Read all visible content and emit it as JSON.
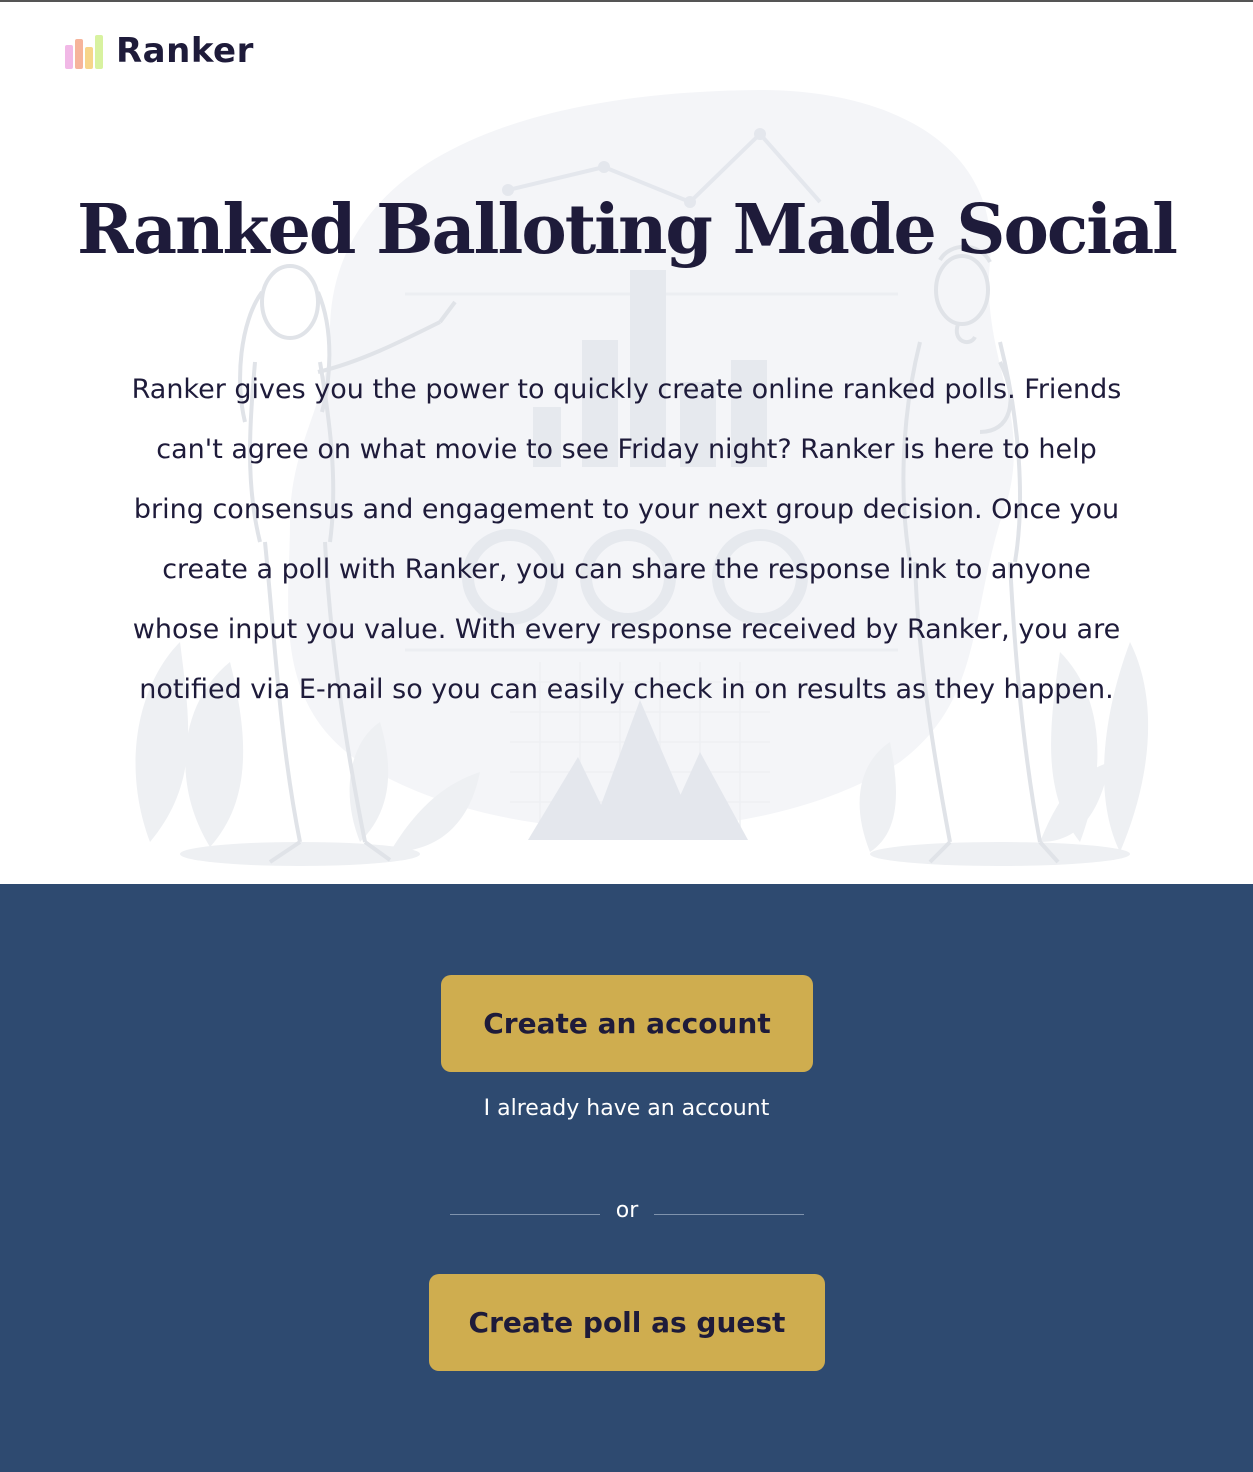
{
  "brand": {
    "name": "Ranker",
    "logo_colors": [
      "#f1b8e6",
      "#f6b49b",
      "#f7d58a",
      "#d8f2a0"
    ]
  },
  "hero": {
    "title": "Ranked Balloting Made Social",
    "description": "Ranker gives you the power to quickly create online ranked polls. Friends can't agree on what movie to see Friday night? Ranker is here to help bring consensus and engagement to your next group decision. Once you create a poll with Ranker, you can share the response link to anyone whose input you value. With every response received by Ranker, you are notified via E-mail so you can easily check in on results as they happen."
  },
  "cta": {
    "create_account_label": "Create an account",
    "login_link_label": "I already have an account",
    "divider_label": "or",
    "guest_label": "Create poll as guest"
  },
  "colors": {
    "cta_background": "#2e4a70",
    "button": "#cfad4f",
    "text_dark": "#1e1b3a"
  }
}
